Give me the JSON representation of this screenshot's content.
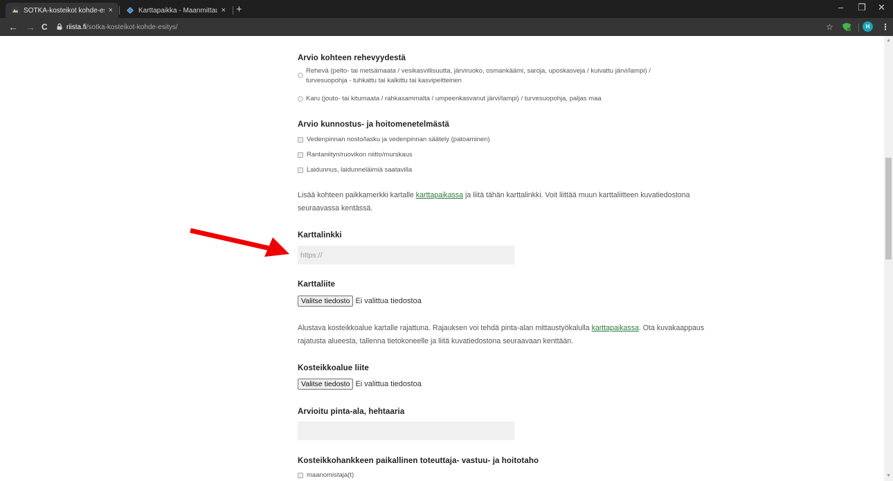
{
  "browser": {
    "tabs": [
      {
        "title": "SOTKA-kosteikot kohde-esitys -",
        "active": true
      },
      {
        "title": "Karttapaikka - Maanmittauslaitos",
        "active": false
      }
    ],
    "new_tab": "+",
    "close_glyph": "×",
    "window_controls": {
      "minimize": "–",
      "maximize": "❐",
      "close": "✕"
    },
    "nav": {
      "back": "←",
      "forward": "→",
      "reload": "C"
    },
    "url_host": "riista.fi",
    "url_path": "/sotka-kosteikot-kohde-esitys/",
    "lock_glyph": "🔒",
    "star_glyph": "☆",
    "profile_initial": "H",
    "menu_glyph": "⋮"
  },
  "form": {
    "rehevyys": {
      "heading": "Arvio kohteen rehevyydestä",
      "options": [
        {
          "line1": "Rehevä (pelto- tai metsämaata / vesikasvillisuutta, järviruoko, osmankäämi, saroja, uposkasveja / kuivattu järvi/lampi) /",
          "line2": "turvesuopohja - tuhkattu tai kalkittu tai kasvipeitteinen"
        },
        {
          "line1": "Karu (jouto- tai kitumaata / rahkasammalta / umpeenkasvanut järvi/lampi) / turvesuopohja, paljas maa"
        }
      ]
    },
    "kunnostus": {
      "heading": "Arvio kunnostus- ja hoitomenetelmästä",
      "options": [
        "Vedenpinnan nosto/lasku ja vedenpinnan säätely (patoaminen)",
        "Rantaniityn/ruovikon niitto/murskaus",
        "Laidunnus, laidunneläimiä saatavilla"
      ]
    },
    "kartta_info": {
      "before_link": "Lisää kohteen paikkamerkki kartalle ",
      "link": "karttapaikassa",
      "after_link": " ja liitä tähän karttalinkki. Voit liittää muun karttaliitteen kuvatiedostona",
      "line2": "seuraavassa kentässä."
    },
    "karttalinkki": {
      "label": "Karttalinkki",
      "placeholder": "https://"
    },
    "karttaliite": {
      "label": "Karttaliite",
      "button": "Valitse tiedosto",
      "status": "Ei valittua tiedostoa"
    },
    "rajaus_info": {
      "before_link": "Alustava kosteikkoalue kartalle rajattuna. Rajauksen voi tehdä pinta-alan mittaustyökalulla ",
      "link": "karttapaikassa",
      "after_link": ". Ota kuvakaappaus",
      "line2": "rajatusta alueesta, tallenna tietokoneelle ja liitä kuvatiedostona seuraavaan kenttään."
    },
    "kosteikkoalue_liite": {
      "label": "Kosteikkoalue liite",
      "button": "Valitse tiedosto",
      "status": "Ei valittua tiedostoa"
    },
    "pinta_ala": {
      "label": "Arvioitu pinta-ala, hehtaaria",
      "value": ""
    },
    "toteuttaja": {
      "heading": "Kosteikkohankkeen paikallinen toteuttaja- vastuu- ja hoitotaho",
      "options": [
        "maanomistaja(t)"
      ]
    }
  },
  "annotation": {
    "arrow_color": "#ee0000"
  },
  "colors": {
    "link": "#2f7a3a",
    "chrome_dark": "#1f1f1f",
    "chrome_mid": "#353535"
  }
}
